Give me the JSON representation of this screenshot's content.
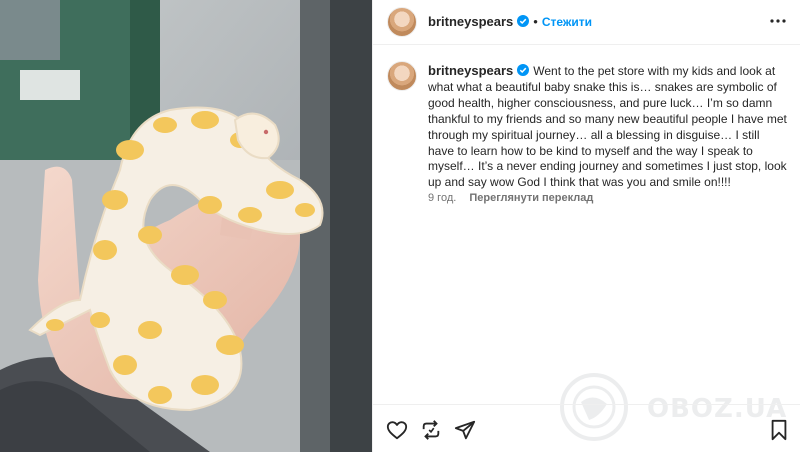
{
  "post": {
    "username": "britneyspears",
    "follow_label": "Стежити",
    "separator": "•",
    "caption": "Went to the pet store with my kids and look at what what a beautiful baby snake this is… snakes are symbolic of good health, higher consciousness, and pure luck… I’m so damn thankful to my friends and so many new beautiful people I have met through my spiritual journey… all a blessing in disguise… I still have to learn how to be kind to myself and the way I speak to myself… It’s a never ending journey and sometimes I just stop, look up and say wow God I think that was you and smile on!!!!",
    "time_ago": "9 год.",
    "see_translation": "Переглянути переклад"
  },
  "icons": {
    "verified": "verified-badge-icon",
    "more": "more-options-icon",
    "like": "heart-icon",
    "repost": "repost-icon",
    "share": "share-icon",
    "save": "bookmark-icon"
  },
  "watermark": {
    "text": "OBOZ.UA"
  },
  "colors": {
    "accent": "#0095f6",
    "text": "#262626",
    "muted": "#737373",
    "divider": "#efefef",
    "snake_base": "#f6efe4",
    "snake_pattern": "#f3c75c"
  }
}
